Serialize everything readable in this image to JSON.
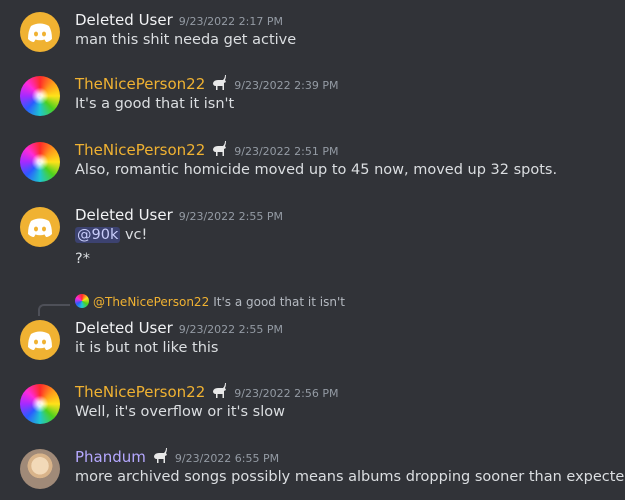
{
  "messages": [
    {
      "author": "Deleted User",
      "time": "9/23/2022 2:17 PM",
      "text": "man this shit needa get active"
    },
    {
      "author": "TheNicePerson22",
      "time": "9/23/2022 2:39 PM",
      "text": "It's a good that it isn't"
    },
    {
      "author": "TheNicePerson22",
      "time": "9/23/2022 2:51 PM",
      "text": "Also, romantic homicide moved up to 45 now, moved up 32 spots."
    },
    {
      "author": "Deleted User",
      "time": "9/23/2022 2:55 PM",
      "mention": "@90k",
      "text": " vc!",
      "text2": "?*"
    },
    {
      "author": "Deleted User",
      "time": "9/23/2022 2:55 PM",
      "text": "it is but not like this",
      "reply": {
        "author": "@TheNicePerson22",
        "text": "It's a good that it isn't"
      }
    },
    {
      "author": "TheNicePerson22",
      "time": "9/23/2022 2:56 PM",
      "text": "Well, it's overflow or it's slow"
    },
    {
      "author": "Phandum",
      "time": "9/23/2022 6:55 PM",
      "text": "more archived songs possibly means albums dropping sooner than expected"
    }
  ],
  "colors": {
    "background": "#313338",
    "deleted_user_name": "#f2f3f5",
    "nice_person_name": "#f0b232",
    "phandum_name": "#b5a8ff",
    "discord_avatar": "#f0b232",
    "mention_bg": "#3c4270"
  },
  "icons": {
    "discord_avatar": "discord-logo-icon",
    "role_badge": "goat-emoji-icon"
  }
}
